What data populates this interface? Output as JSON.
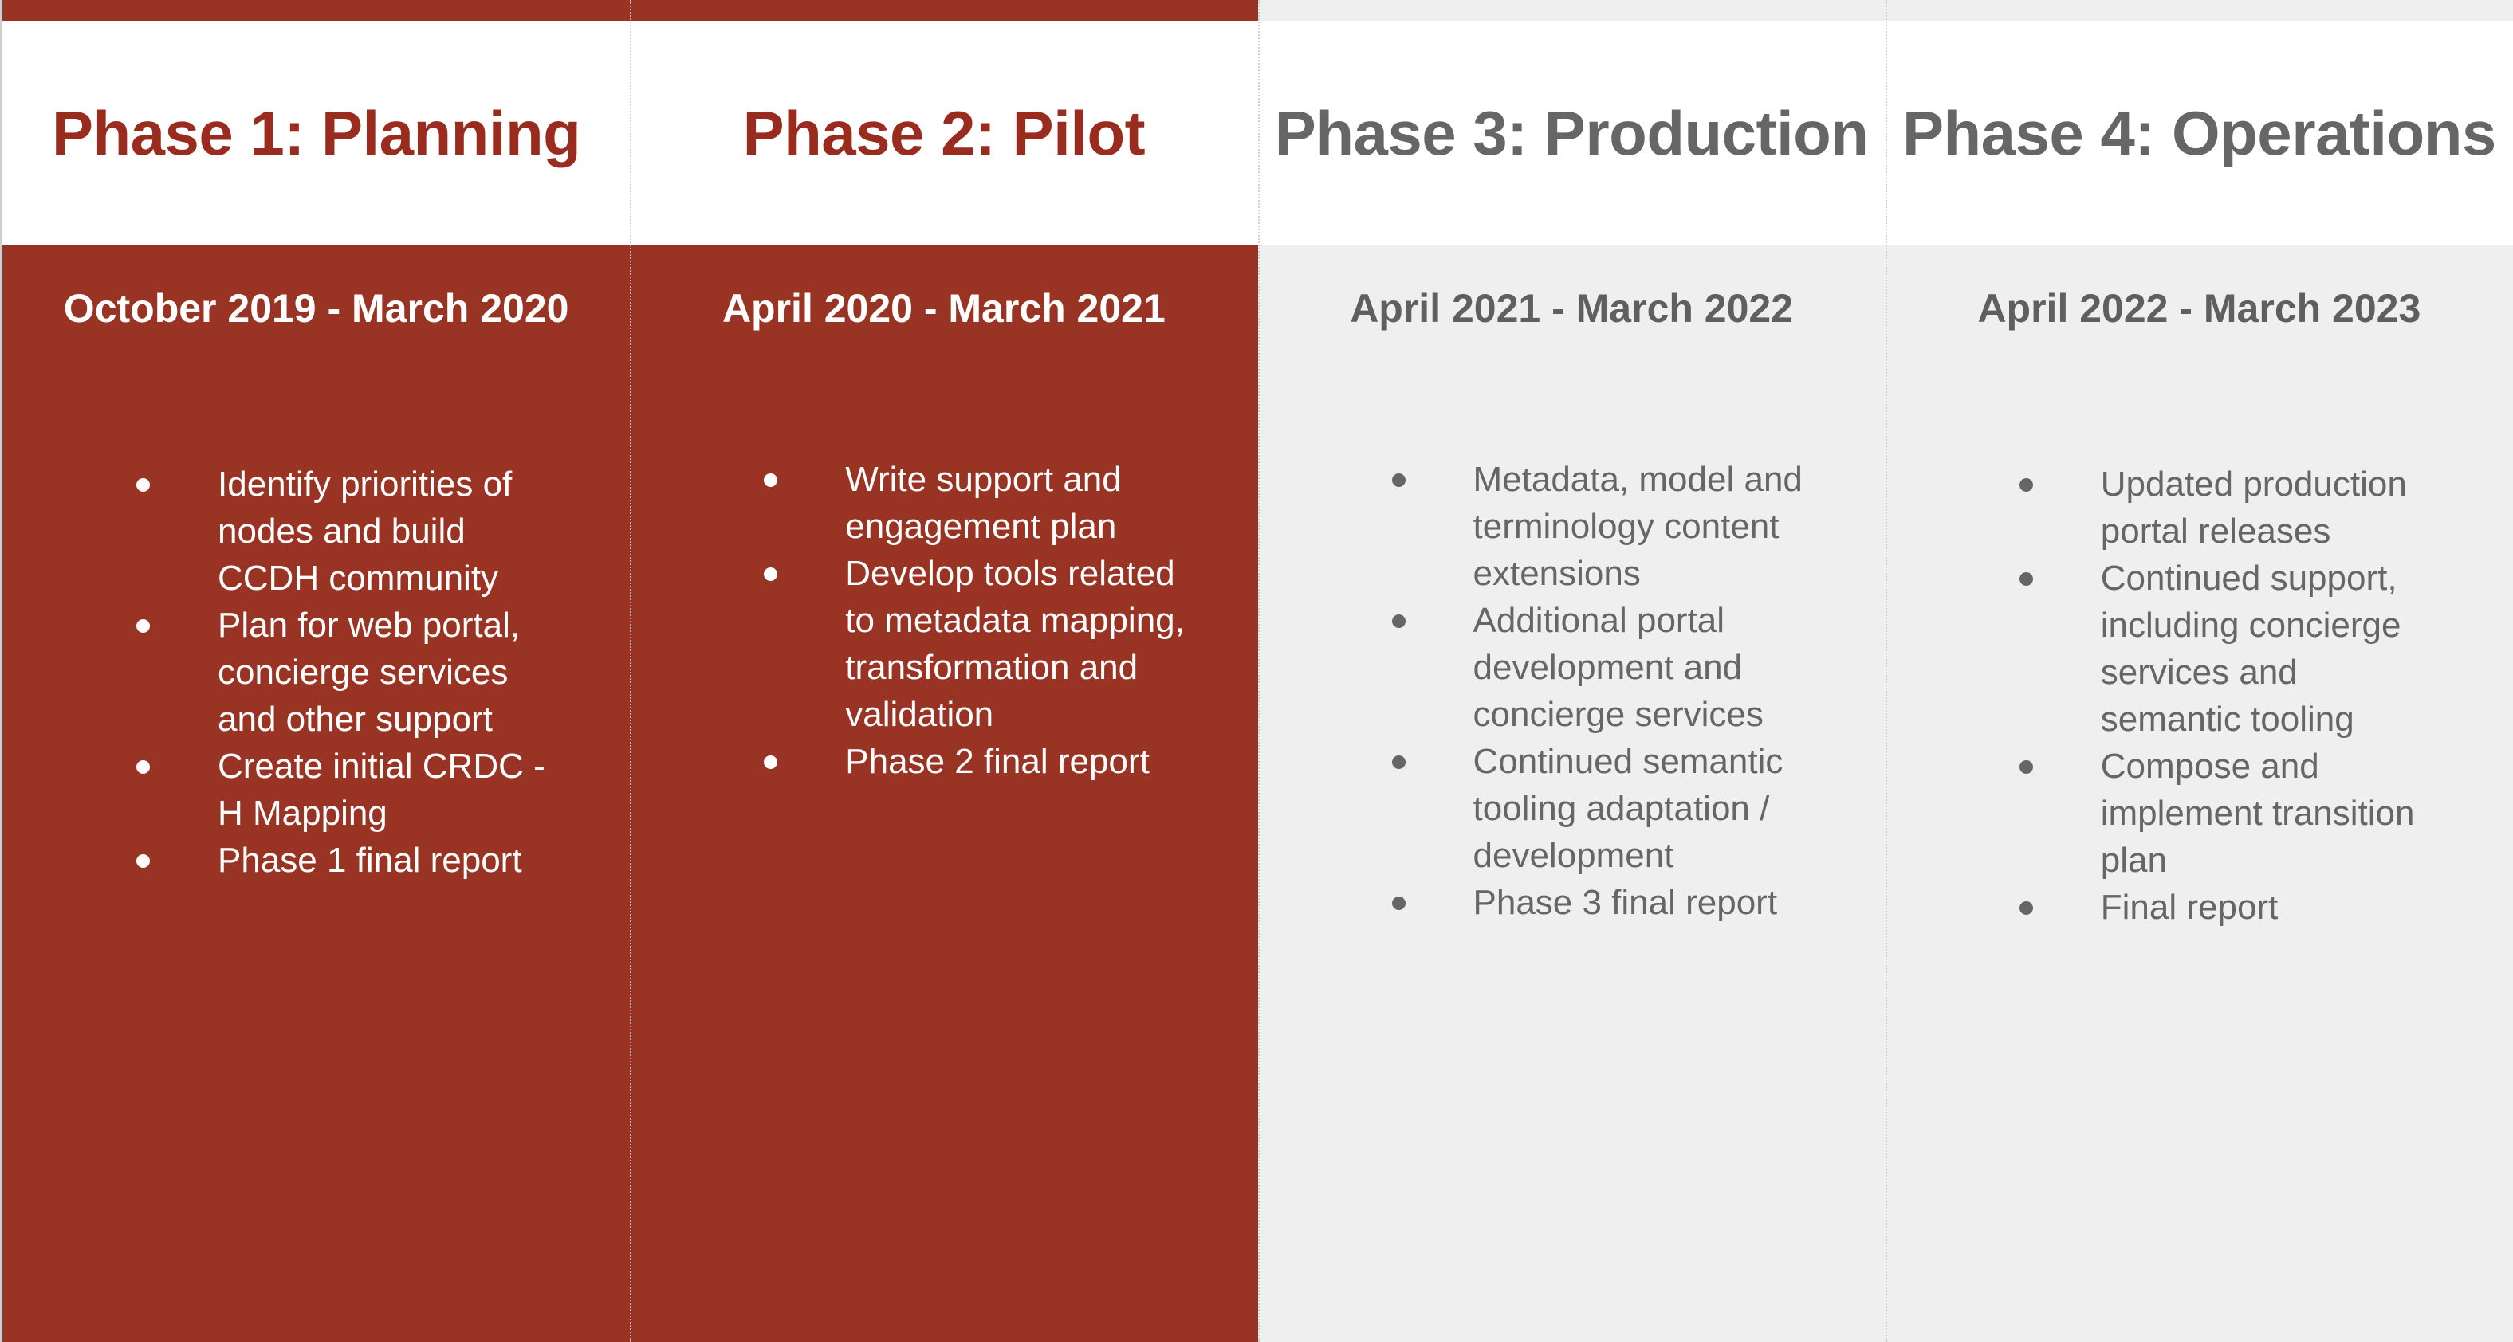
{
  "phases": [
    {
      "title": "Phase 1: Planning",
      "dates": "October 2019 - March 2020",
      "items": [
        "Identify priorities of nodes and build CCDH community",
        "Plan for web portal, concierge services and other support",
        "Create initial CRDC -H Mapping",
        "Phase 1 final report"
      ]
    },
    {
      "title": "Phase 2: Pilot",
      "dates": "April 2020 - March 2021",
      "items": [
        "Write support and engagement plan",
        "Develop tools related to metadata mapping, transformation and validation",
        "Phase 2 final report"
      ]
    },
    {
      "title": "Phase 3: Production",
      "dates": "April 2021 - March 2022",
      "items": [
        "Metadata, model and terminology content extensions",
        "Additional portal development and concierge services",
        "Continued semantic tooling adaptation / development",
        "Phase 3 final report"
      ]
    },
    {
      "title": "Phase 4: Operations",
      "dates": "April 2022 - March 2023",
      "items": [
        "Updated production portal releases",
        "Continued support, including concierge services and semantic tooling",
        "Compose and implement transition plan",
        "Final report"
      ]
    }
  ],
  "colors": {
    "active_fill": "#993324",
    "active_title": "#9a2c1f",
    "future_fill": "#efefef",
    "future_text": "#666666"
  }
}
